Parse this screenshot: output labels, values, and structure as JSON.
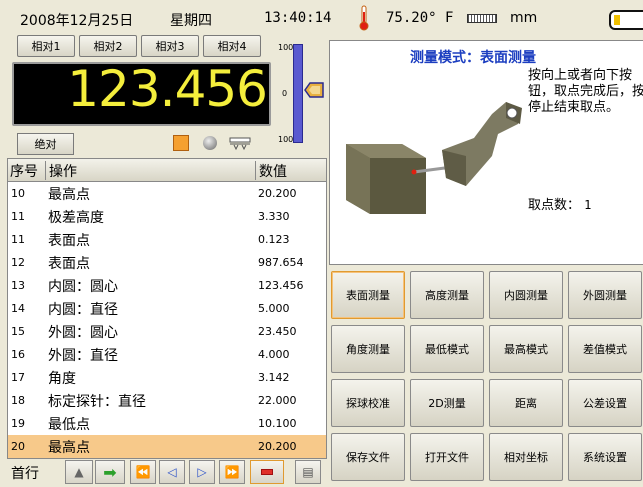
{
  "status_bar": {
    "date": "2008年12月25日",
    "weekday": "星期四",
    "time": "13:40:14",
    "temperature": "75.20° F",
    "unit": "mm"
  },
  "relative_buttons": [
    "相对1",
    "相对2",
    "相对3",
    "相对4"
  ],
  "display": {
    "value": "123.456"
  },
  "scale": {
    "top": "100",
    "mid": "0",
    "bottom": "100"
  },
  "absolute_button": "绝对",
  "table": {
    "headers": [
      "序号",
      "操作",
      "数值"
    ],
    "rows": [
      {
        "n": "10",
        "op": "最高点",
        "val": "20.200"
      },
      {
        "n": "11",
        "op": "极差高度",
        "val": "3.330"
      },
      {
        "n": "11",
        "op": "表面点",
        "val": "0.123"
      },
      {
        "n": "12",
        "op": "表面点",
        "val": "987.654"
      },
      {
        "n": "13",
        "op": "内圆：圆心",
        "val": "123.456"
      },
      {
        "n": "14",
        "op": "内圆：直径",
        "val": "5.000"
      },
      {
        "n": "15",
        "op": "外圆：圆心",
        "val": "23.450"
      },
      {
        "n": "16",
        "op": "外圆：直径",
        "val": "4.000"
      },
      {
        "n": "17",
        "op": "角度",
        "val": "3.142"
      },
      {
        "n": "18",
        "op": "标定探针：直径",
        "val": "22.000"
      },
      {
        "n": "19",
        "op": "最低点",
        "val": "10.100"
      },
      {
        "n": "20",
        "op": "最高点",
        "val": "20.200"
      }
    ],
    "selected_index": 11
  },
  "bottom_toolbar": {
    "first_row_label": "首行"
  },
  "measure_panel": {
    "title": "测量模式：表面测量",
    "instruction": "按向上或者向下按钮，取点完成后，按停止结束取点。",
    "count_label": "取点数：",
    "count_value": "1"
  },
  "mode_buttons": [
    "表面测量",
    "高度测量",
    "内圆测量",
    "外圆测量",
    "角度测量",
    "最低模式",
    "最高模式",
    "差值模式",
    "探球校准",
    "2D测量",
    "距离",
    "公差设置",
    "保存文件",
    "打开文件",
    "相对坐标",
    "系统设置"
  ],
  "active_mode_index": 0,
  "colors": {
    "display_digits": "#f4ee3c",
    "selected_row": "#f7c98a",
    "title_blue": "#1c3ec0",
    "scale_bar": "#5a5ad0"
  }
}
